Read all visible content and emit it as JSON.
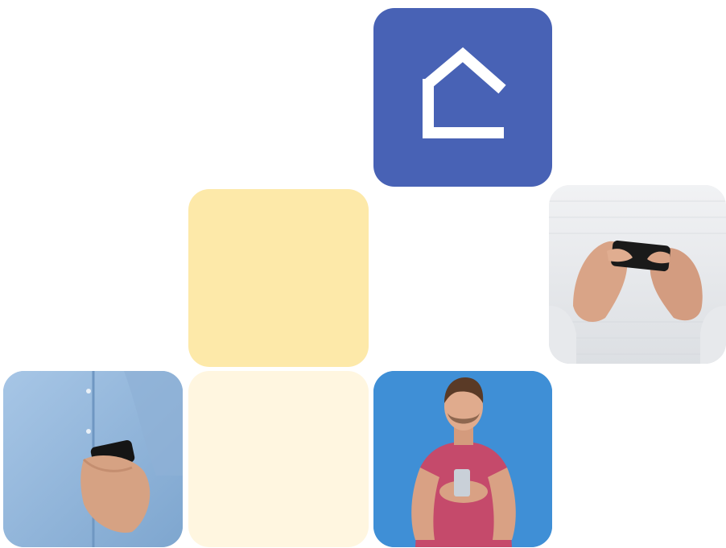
{
  "colors": {
    "app_tile": "#4862b5",
    "app_icon_stroke": "#ffffff",
    "yellow_tile": "#fde9a9",
    "cream_tile": "#fff6e0",
    "hands_bg": "#e9ebee",
    "shirt_blue": "#8fb4d8",
    "man_bg": "#3f8fd6",
    "man_shirt": "#c54a6b"
  },
  "icons": {
    "app": "home-icon"
  }
}
